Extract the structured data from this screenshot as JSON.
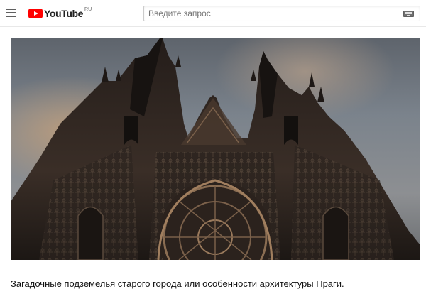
{
  "header": {
    "logo_text": "YouTube",
    "logo_region": "RU",
    "menu_icon": "hamburger-menu-icon",
    "keyboard_icon": "keyboard-icon"
  },
  "search": {
    "placeholder": "Введите запрос",
    "value": ""
  },
  "video": {
    "title": "Загадочные подземелья старого города или особенности архитектуры Праги."
  },
  "colors": {
    "brand": "#ff0000",
    "sky": "#6f7a86",
    "stone": "#2a2320"
  }
}
